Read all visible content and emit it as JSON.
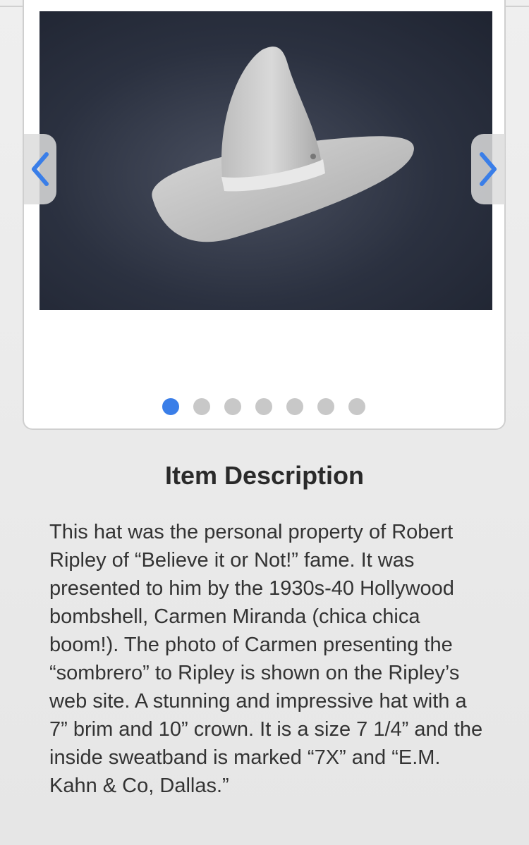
{
  "gallery": {
    "image_alt": "Gray felt sombrero hat on dark background",
    "prev_icon": "chevron-left-icon",
    "next_icon": "chevron-right-icon",
    "slide_count": 7,
    "active_index": 0,
    "accent_color": "#3a7ee8"
  },
  "description": {
    "heading": "Item Description",
    "text": "This hat was the personal property of Robert Ripley of “Believe it or Not!” fame. It was presented to him by the 1930s-40 Hollywood bombshell, Carmen Miranda (chica chica boom!). The photo of Carmen presenting the “sombrero” to Ripley is shown on the Ripley’s web site. A stunning and impressive hat with a 7” brim and 10” crown. It is a size 7 1/4” and the inside sweatband is marked “7X” and “E.M. Kahn & Co, Dallas.”"
  }
}
